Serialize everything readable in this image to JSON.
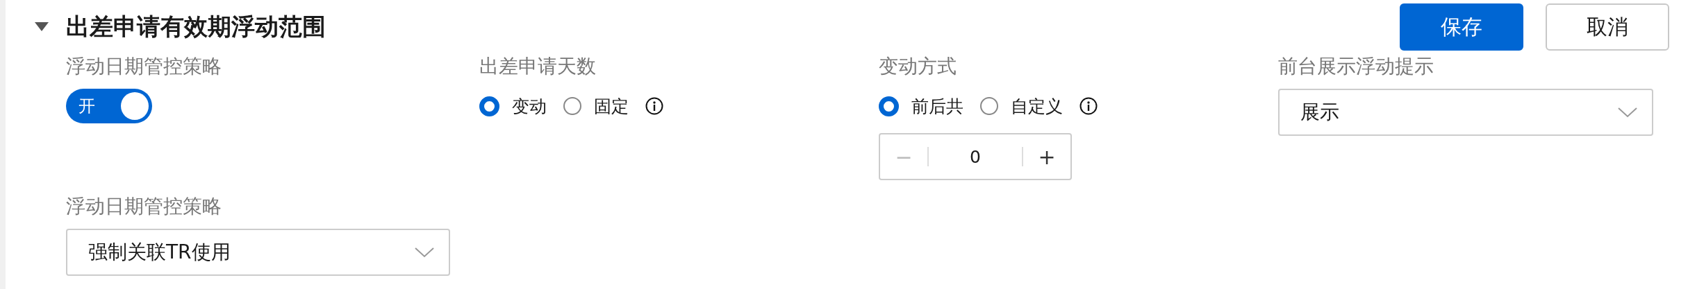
{
  "section": {
    "title": "出差申请有效期浮动范围",
    "expanded": true
  },
  "buttons": [
    {
      "label": "保存",
      "kind": "primary"
    },
    {
      "label": "取消",
      "kind": "secondary"
    }
  ],
  "fields": [
    {
      "kind": "switch",
      "label": "浮动日期管控策略",
      "on": true,
      "text": "开"
    },
    {
      "kind": "radio",
      "label": "出差申请天数",
      "info": true,
      "options": [
        {
          "label": "变动",
          "selected": true
        },
        {
          "label": "固定",
          "selected": false
        }
      ]
    },
    {
      "kind": "radio",
      "label": "变动方式",
      "info": true,
      "options": [
        {
          "label": "前后共",
          "selected": true
        },
        {
          "label": "自定义",
          "selected": false
        }
      ],
      "stepper": {
        "value": "0",
        "minus": "−",
        "plus": "+"
      }
    },
    {
      "kind": "select",
      "label": "前台展示浮动提示",
      "value": "展示"
    },
    {
      "kind": "select",
      "label": "浮动日期管控策略",
      "value": "强制关联TR使用"
    }
  ]
}
